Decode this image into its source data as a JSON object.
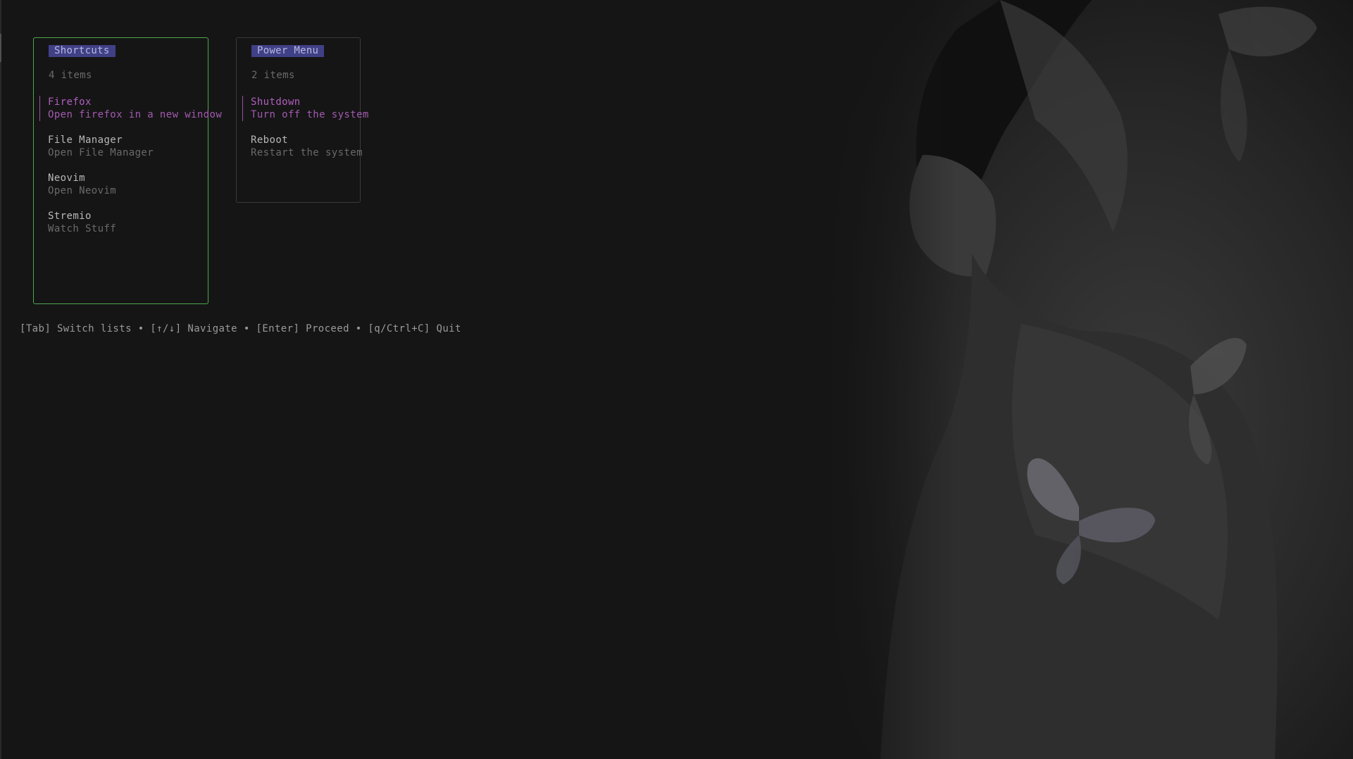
{
  "panels": {
    "shortcuts": {
      "title": "Shortcuts",
      "count": "4 items",
      "items": [
        {
          "name": "Firefox",
          "desc": "Open firefox in a new window"
        },
        {
          "name": "File Manager",
          "desc": "Open File Manager"
        },
        {
          "name": "Neovim",
          "desc": "Open Neovim"
        },
        {
          "name": "Stremio",
          "desc": "Watch Stuff"
        }
      ]
    },
    "power": {
      "title": "Power Menu",
      "count": "2 items",
      "items": [
        {
          "name": "Shutdown",
          "desc": "Turn off the system"
        },
        {
          "name": "Reboot",
          "desc": "Restart the system"
        }
      ]
    }
  },
  "help": "[Tab] Switch lists • [↑/↓] Navigate • [Enter] Proceed • [q/Ctrl+C] Quit",
  "colors": {
    "background": "#151515",
    "active_border": "#4fa64f",
    "title_bg": "#404087",
    "selected": "#b15fbf"
  }
}
